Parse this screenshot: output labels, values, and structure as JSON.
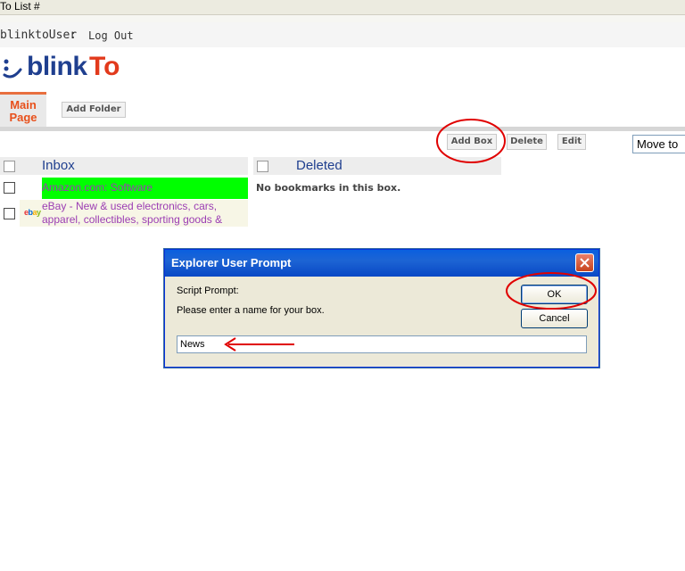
{
  "window": {
    "title": "To List #"
  },
  "user_bar": {
    "username": "blinktoUser",
    "separator": ":",
    "logout_label": "Log Out"
  },
  "logo": {
    "part1": "blink",
    "part2": "To"
  },
  "tabs": [
    {
      "label_line1": "Main",
      "label_line2": "Page",
      "active": true
    }
  ],
  "folder_actions": {
    "add_folder_label": "Add Folder"
  },
  "toolbar": {
    "add_box_label": "Add Box",
    "delete_label": "Delete",
    "edit_label": "Edit",
    "move_to_label": "Move to"
  },
  "boxes": [
    {
      "title": "Inbox",
      "rows": [
        {
          "title": "Amazon.com: Software",
          "highlighted": true
        },
        {
          "title": "eBay - New & used electronics, cars, apparel, collectibles, sporting goods &",
          "favicon": "ebay-icon"
        }
      ]
    },
    {
      "title": "Deleted",
      "empty_text": "No bookmarks in this box."
    }
  ],
  "dialog": {
    "title": "Explorer User Prompt",
    "label": "Script Prompt:",
    "message": "Please enter a name for your box.",
    "ok_label": "OK",
    "cancel_label": "Cancel",
    "input_value": "News"
  },
  "colors": {
    "brand_blue": "#1f3f8f",
    "brand_red": "#e23a1c",
    "annotation_red": "#e00000",
    "highlight_green": "#00ff00",
    "link_purple": "#9b3db3"
  }
}
